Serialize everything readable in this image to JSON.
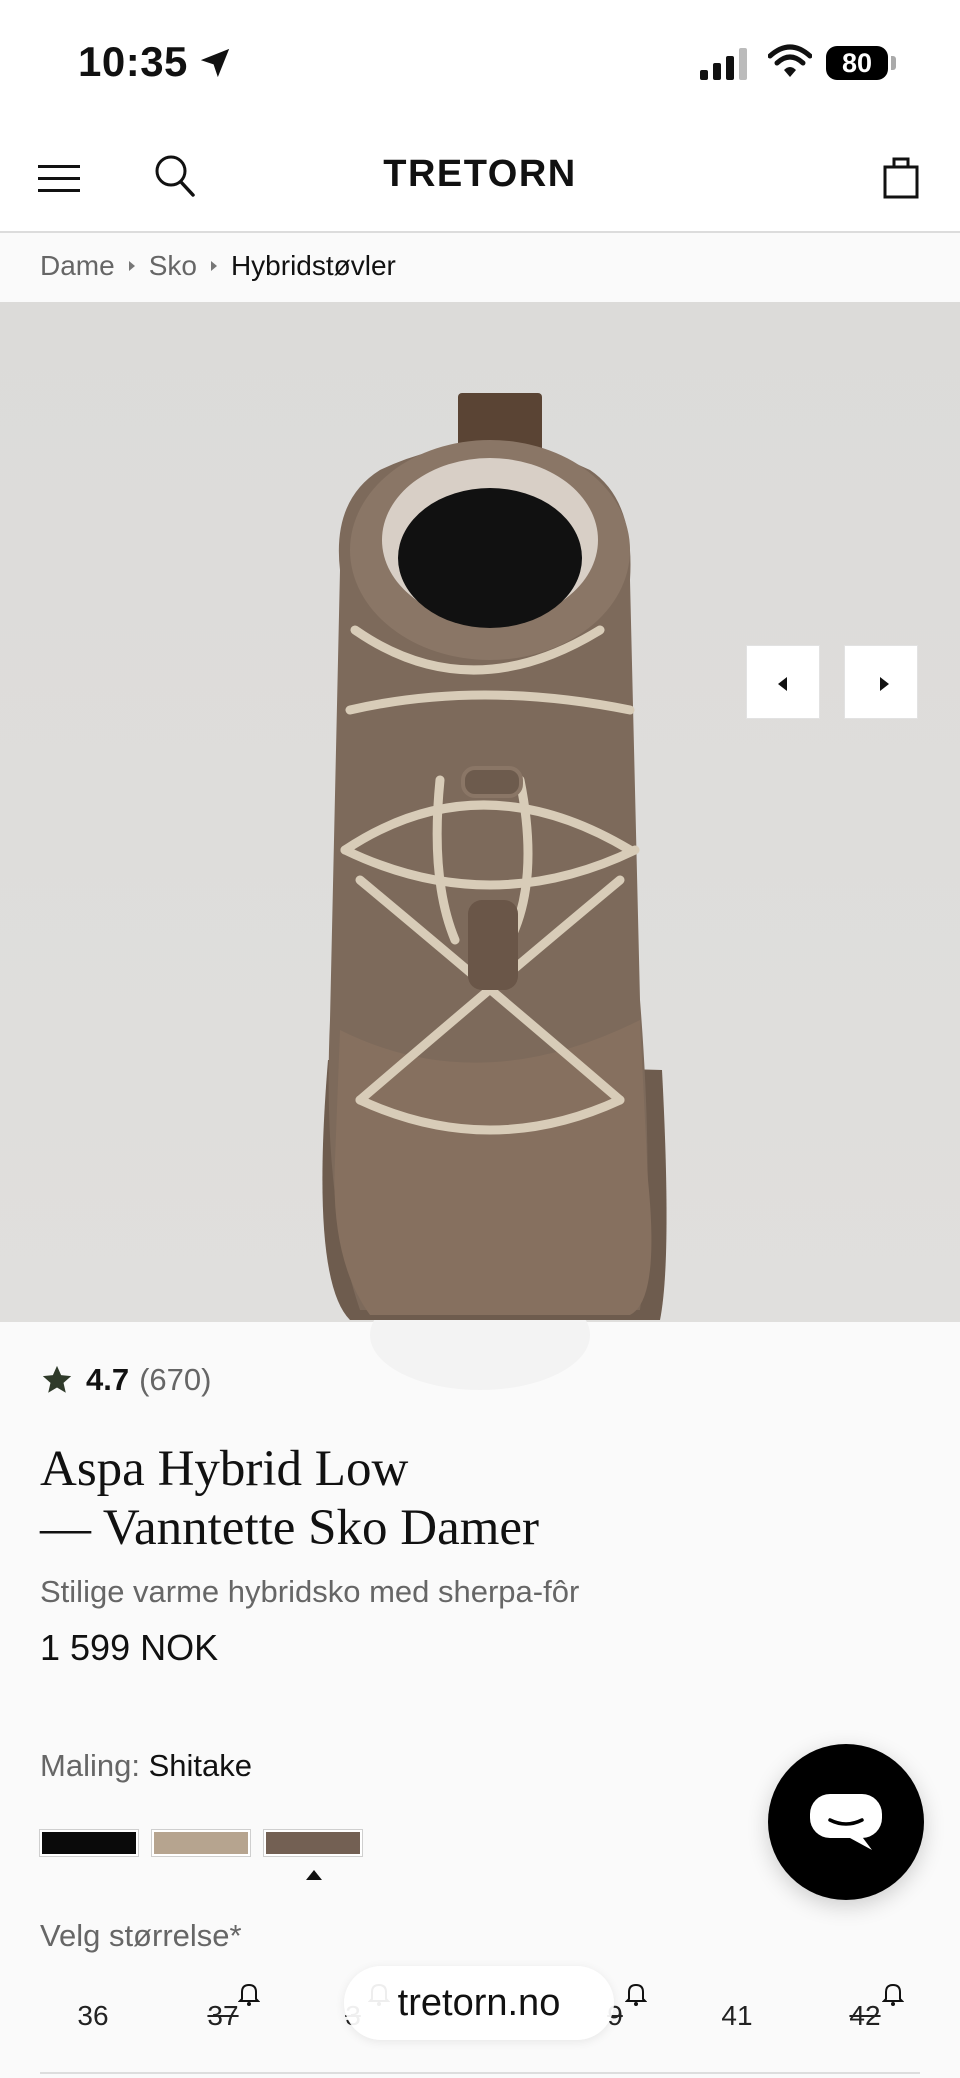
{
  "status_bar": {
    "time": "10:35",
    "battery": "80"
  },
  "header": {
    "logo": "TRETORN"
  },
  "breadcrumb": [
    "Dame",
    "Sko",
    "Hybridstøvler"
  ],
  "product": {
    "rating": "4.7",
    "review_count": "(670)",
    "title_line1": "Aspa Hybrid Low",
    "title_line2": "— Vanntette Sko Damer",
    "subtitle": "Stilige varme hybridsko med sherpa-fôr",
    "price": "1 599 NOK"
  },
  "color": {
    "label": "Maling:",
    "selected": "Shitake",
    "swatches": [
      {
        "color": "#0a0a0a"
      },
      {
        "color": "#b6a48f"
      },
      {
        "color": "#736053",
        "selected": true
      }
    ]
  },
  "size": {
    "label": "Velg størrelse*",
    "options": [
      {
        "label": "36",
        "in_stock": true
      },
      {
        "label": "37",
        "in_stock": false
      },
      {
        "label": "3",
        "in_stock": false
      },
      {
        "label": "9",
        "in_stock": false
      },
      {
        "label": "41",
        "in_stock": true
      },
      {
        "label": "42",
        "in_stock": false
      }
    ]
  },
  "browser": {
    "url": "tretorn.no"
  },
  "icons": [
    "location-arrow-icon",
    "signal-icon",
    "wifi-icon",
    "menu-icon",
    "search-icon",
    "bag-icon",
    "star-icon",
    "bell-icon",
    "chat-icon"
  ]
}
